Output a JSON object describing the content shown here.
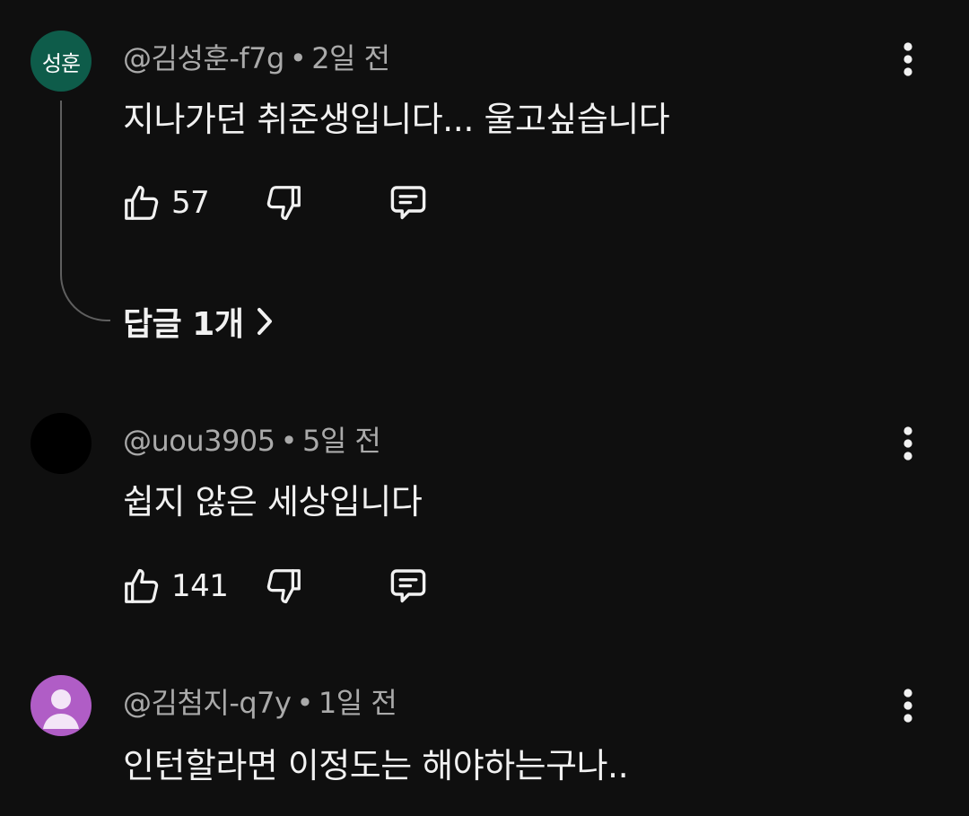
{
  "colors": {
    "background": "#0f0f0f",
    "text_primary": "#f1f1f1",
    "text_secondary": "#aaaaaa",
    "avatar_green": "#0e5c4a",
    "avatar_black": "#000000",
    "avatar_purple": "#b05dc6"
  },
  "comments": [
    {
      "avatar_text": "성훈",
      "author": "@김성훈-f7g",
      "separator": "•",
      "time": "2일 전",
      "text": "지나가던 취준생입니다... 울고싶습니다",
      "likes": "57",
      "replies_label": "답글 1개"
    },
    {
      "avatar_text": "",
      "author": "@uou3905",
      "separator": "•",
      "time": "5일 전",
      "text": "쉽지 않은 세상입니다",
      "likes": "141"
    },
    {
      "avatar_text": "",
      "author": "@김첨지-q7y",
      "separator": "•",
      "time": "1일 전",
      "text": "인턴할라면 이정도는 해야하는구나.."
    }
  ],
  "icons": {
    "like": "thumbs-up-icon",
    "dislike": "thumbs-down-icon",
    "reply": "comment-icon",
    "more": "more-vertical-icon",
    "chevron": "chevron-right-icon",
    "person": "person-icon"
  }
}
